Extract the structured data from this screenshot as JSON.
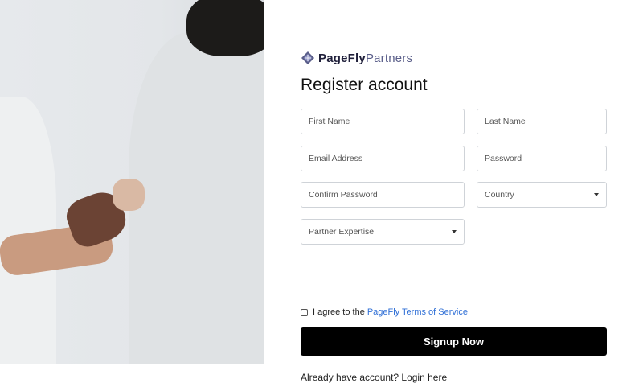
{
  "brand": {
    "name_bold": "PageFly",
    "name_light": "Partners",
    "mark_color": "#5b5f8a"
  },
  "page_title": "Register account",
  "fields": {
    "first_name": "First Name",
    "last_name": "Last Name",
    "email": "Email Address",
    "password": "Password",
    "confirm_password": "Confirm Password",
    "country": "Country",
    "partner_expertise": "Partner Expertise"
  },
  "agree": {
    "text": "I agree to the",
    "link": "PageFly Terms of Service",
    "checked": false
  },
  "signup_label": "Signup Now",
  "login_text": "Already have account? Login here"
}
